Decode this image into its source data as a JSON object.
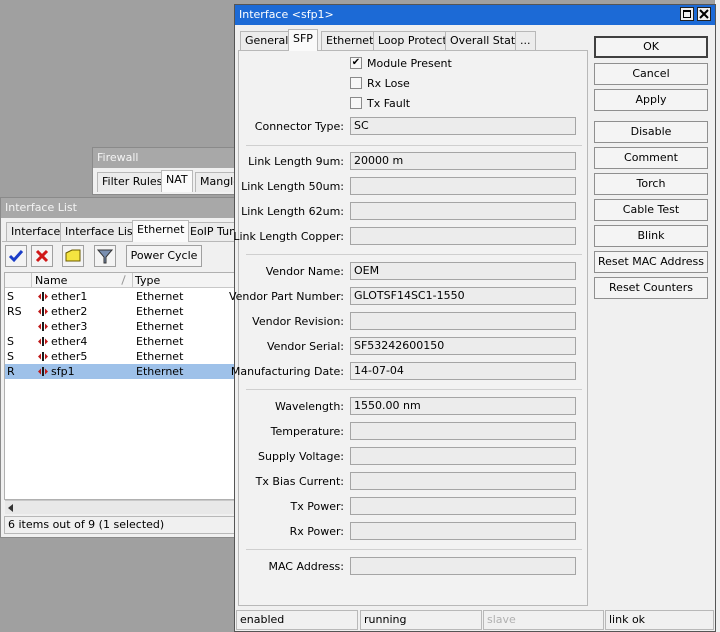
{
  "firewall": {
    "title": "Firewall",
    "tabs": [
      "Filter Rules",
      "NAT",
      "Mangle"
    ]
  },
  "iflist": {
    "title": "Interface List",
    "tabs": [
      "Interface",
      "Interface List",
      "Ethernet",
      "EoIP Tun"
    ],
    "toolbar": {
      "power_cycle": "Power Cycle"
    },
    "columns": [
      "Name",
      "Type"
    ],
    "rows": [
      {
        "flag": "S",
        "name": "ether1",
        "type": "Ethernet"
      },
      {
        "flag": "RS",
        "name": "ether2",
        "type": "Ethernet"
      },
      {
        "flag": "",
        "name": "ether3",
        "type": "Ethernet"
      },
      {
        "flag": "S",
        "name": "ether4",
        "type": "Ethernet"
      },
      {
        "flag": "S",
        "name": "ether5",
        "type": "Ethernet"
      },
      {
        "flag": "R",
        "name": "sfp1",
        "type": "Ethernet"
      }
    ],
    "status": "6 items out of 9 (1 selected)"
  },
  "dialog": {
    "title": "Interface <sfp1>",
    "tabs": [
      "General",
      "SFP",
      "Ethernet",
      "Loop Protect",
      "Overall Stats",
      "..."
    ],
    "checkboxes": [
      {
        "label": "Module Present",
        "checked": true
      },
      {
        "label": "Rx Lose",
        "checked": false
      },
      {
        "label": "Tx Fault",
        "checked": false
      }
    ],
    "fields": {
      "connector_type": {
        "label": "Connector Type:",
        "value": "SC"
      },
      "link_9um": {
        "label": "Link Length 9um:",
        "value": "20000 m"
      },
      "link_50um": {
        "label": "Link Length 50um:",
        "value": ""
      },
      "link_62um": {
        "label": "Link Length 62um:",
        "value": ""
      },
      "link_copper": {
        "label": "Link Length Copper:",
        "value": ""
      },
      "vendor_name": {
        "label": "Vendor Name:",
        "value": "OEM"
      },
      "vendor_part": {
        "label": "Vendor Part Number:",
        "value": "GLOTSF14SC1-1550"
      },
      "vendor_rev": {
        "label": "Vendor Revision:",
        "value": ""
      },
      "vendor_serial": {
        "label": "Vendor Serial:",
        "value": "SF53242600150"
      },
      "mfg_date": {
        "label": "Manufacturing Date:",
        "value": "14-07-04"
      },
      "wavelength": {
        "label": "Wavelength:",
        "value": "1550.00 nm"
      },
      "temperature": {
        "label": "Temperature:",
        "value": ""
      },
      "supply_voltage": {
        "label": "Supply Voltage:",
        "value": ""
      },
      "tx_bias": {
        "label": "Tx Bias Current:",
        "value": ""
      },
      "tx_power": {
        "label": "Tx Power:",
        "value": ""
      },
      "rx_power": {
        "label": "Rx Power:",
        "value": ""
      },
      "mac": {
        "label": "MAC Address:",
        "value": ""
      }
    },
    "buttons": {
      "ok": "OK",
      "cancel": "Cancel",
      "apply": "Apply",
      "disable": "Disable",
      "comment": "Comment",
      "torch": "Torch",
      "cable_test": "Cable Test",
      "blink": "Blink",
      "reset_mac": "Reset MAC Address",
      "reset_counters": "Reset Counters"
    },
    "status": [
      "enabled",
      "running",
      "slave",
      "link ok"
    ]
  }
}
